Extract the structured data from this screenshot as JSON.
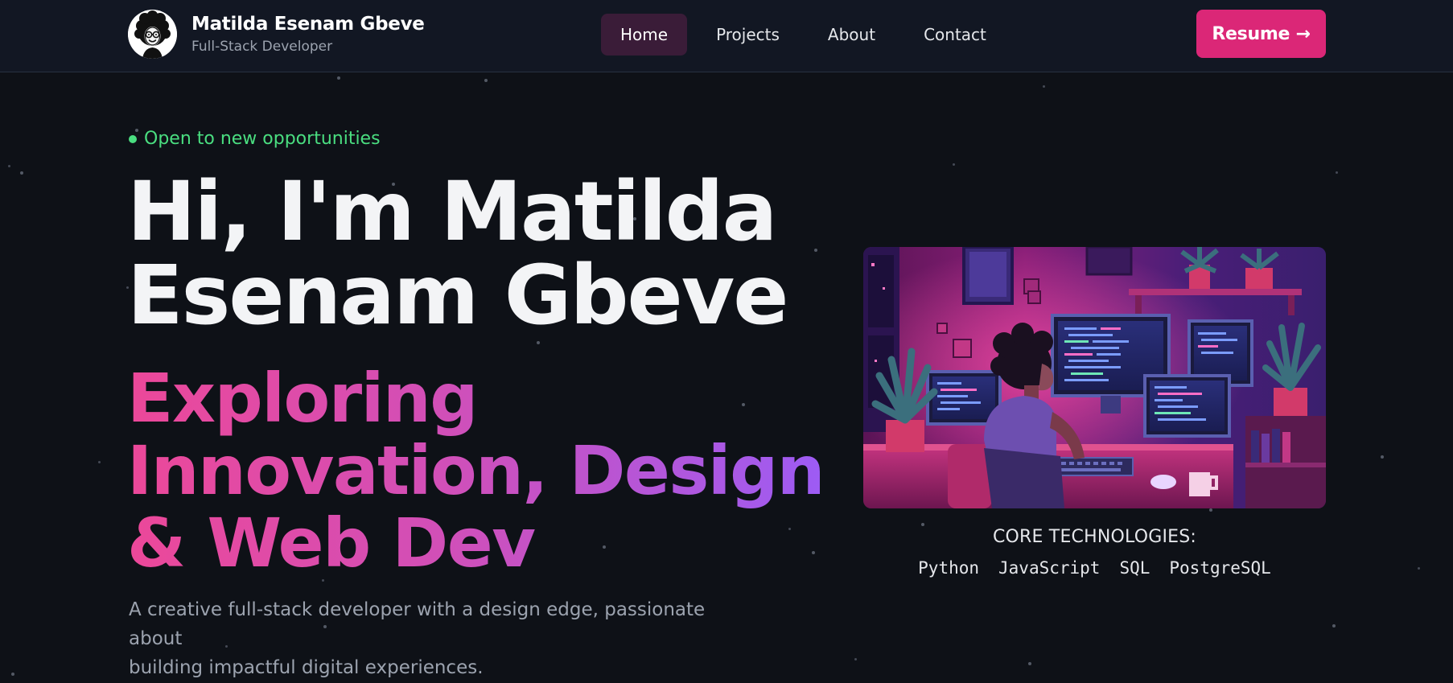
{
  "header": {
    "brand_name": "Matilda Esenam Gbeve",
    "brand_role": "Full-Stack Developer",
    "nav": [
      {
        "label": "Home",
        "active": true
      },
      {
        "label": "Projects",
        "active": false
      },
      {
        "label": "About",
        "active": false
      },
      {
        "label": "Contact",
        "active": false
      }
    ],
    "resume_label": "Resume →"
  },
  "hero": {
    "status": "Open to new opportunities",
    "title_line1": "Hi, I'm Matilda",
    "title_line2": "Esenam Gbeve",
    "subtitle_line1": "Exploring",
    "subtitle_line2": "Innovation, Design",
    "subtitle_line3": "& Web Dev",
    "description_line1": "A creative full-stack developer with a design edge, passionate about",
    "description_line2": "building impactful digital experiences."
  },
  "tech": {
    "heading": "CORE TECHNOLOGIES:",
    "items": [
      "Python",
      "JavaScript",
      "SQL",
      "PostgreSQL"
    ]
  },
  "colors": {
    "background": "#0e1117",
    "header_bg": "#121723",
    "accent_pink": "#db2777",
    "status_green": "#4ade80",
    "gradient_start": "#ec4899",
    "gradient_end": "#9b5cf6"
  },
  "icons": {
    "avatar": "afro-portrait-icon",
    "status": "status-dot-icon"
  }
}
